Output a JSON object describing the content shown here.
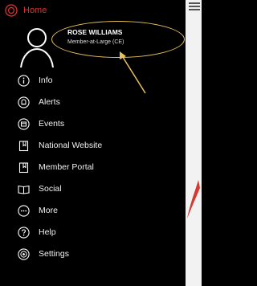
{
  "header": {
    "home_label": "Home"
  },
  "profile": {
    "name": "ROSE WILLIAMS",
    "role": "Member-at-Large (CE)"
  },
  "menu": {
    "items": [
      {
        "label": "Info",
        "icon": "info-icon"
      },
      {
        "label": "Alerts",
        "icon": "bell-icon"
      },
      {
        "label": "Events",
        "icon": "calendar-icon"
      },
      {
        "label": "National Website",
        "icon": "bookmark-icon"
      },
      {
        "label": "Member Portal",
        "icon": "bookmark-icon"
      },
      {
        "label": "Social",
        "icon": "book-open-icon"
      },
      {
        "label": "More",
        "icon": "more-dots-icon"
      },
      {
        "label": "Help",
        "icon": "question-icon"
      },
      {
        "label": "Settings",
        "icon": "gear-icon"
      }
    ]
  },
  "colors": {
    "accent": "#e0322f",
    "highlight": "#e8c15a",
    "background": "#000000"
  }
}
